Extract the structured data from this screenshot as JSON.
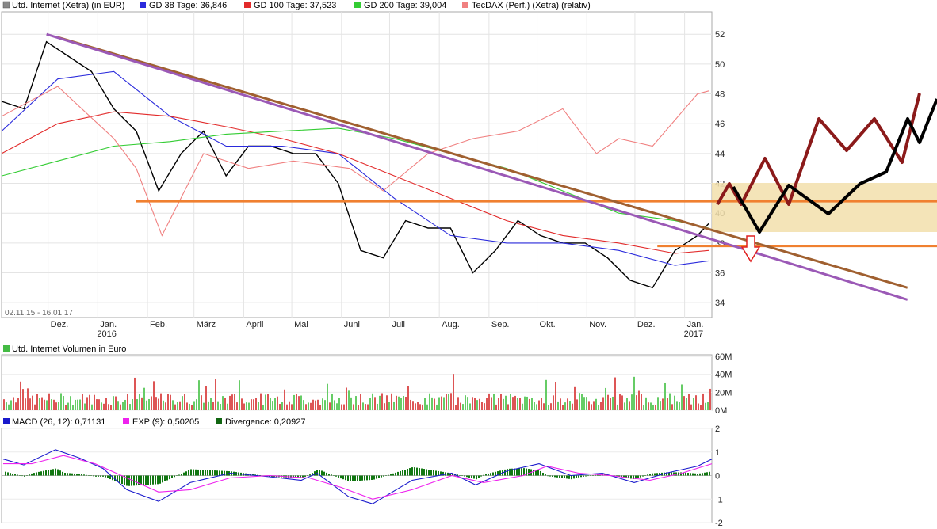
{
  "legend_main": [
    {
      "label": "Utd. Internet (Xetra) (in EUR)",
      "color": "#888888"
    },
    {
      "label": "GD 38 Tage: 36,846",
      "color": "#2a2adc"
    },
    {
      "label": "GD 100 Tage: 37,523",
      "color": "#e22a2a"
    },
    {
      "label": "GD 200 Tage: 39,004",
      "color": "#33cc33"
    },
    {
      "label": "TecDAX (Perf.) (Xetra) (relativ)",
      "color": "#f08080"
    }
  ],
  "date_range": "02.11.15 - 16.01.17",
  "legend_volume": [
    {
      "label": "Utd. Internet Volumen in Euro",
      "color": "#44bb44"
    }
  ],
  "legend_macd": [
    {
      "label": "MACD (26, 12): 0,71131",
      "color": "#1a1acc"
    },
    {
      "label": "EXP (9): 0,50205",
      "color": "#ee22ee"
    },
    {
      "label": "Divergence: 0,20927",
      "color": "#116611"
    }
  ],
  "x_ticks": [
    {
      "label": "Dez.",
      "sub": ""
    },
    {
      "label": "Jan.",
      "sub": "2016"
    },
    {
      "label": "Feb.",
      "sub": ""
    },
    {
      "label": "März",
      "sub": ""
    },
    {
      "label": "April",
      "sub": ""
    },
    {
      "label": "Mai",
      "sub": ""
    },
    {
      "label": "Juni",
      "sub": ""
    },
    {
      "label": "Juli",
      "sub": ""
    },
    {
      "label": "Aug.",
      "sub": ""
    },
    {
      "label": "Sep.",
      "sub": ""
    },
    {
      "label": "Okt.",
      "sub": ""
    },
    {
      "label": "Nov.",
      "sub": ""
    },
    {
      "label": "Dez.",
      "sub": ""
    },
    {
      "label": "Jan.",
      "sub": "2017"
    }
  ],
  "chart_data": [
    {
      "type": "line",
      "panel": "price",
      "ylim": [
        33,
        53.5
      ],
      "y_ticks": [
        34,
        36,
        38,
        40,
        42,
        44,
        46,
        48,
        50,
        52
      ],
      "grid": true,
      "series": [
        {
          "name": "Utd. Internet (Xetra) (in EUR)",
          "color": "#000000",
          "x": [
            "2015-11-02",
            "2015-11-16",
            "2015-11-30",
            "2015-12-14",
            "2015-12-28",
            "2016-01-11",
            "2016-01-25",
            "2016-02-08",
            "2016-02-22",
            "2016-03-07",
            "2016-03-21",
            "2016-04-04",
            "2016-04-18",
            "2016-05-02",
            "2016-05-16",
            "2016-05-30",
            "2016-06-13",
            "2016-06-27",
            "2016-07-11",
            "2016-07-25",
            "2016-08-08",
            "2016-08-22",
            "2016-09-05",
            "2016-09-19",
            "2016-10-03",
            "2016-10-17",
            "2016-10-31",
            "2016-11-14",
            "2016-11-28",
            "2016-12-12",
            "2016-12-26",
            "2017-01-09",
            "2017-01-16"
          ],
          "values": [
            47.5,
            47.0,
            51.5,
            50.5,
            49.5,
            47.0,
            45.5,
            41.5,
            44.0,
            45.5,
            42.5,
            44.5,
            44.5,
            44.0,
            44.0,
            42.0,
            37.5,
            37.0,
            39.5,
            39.0,
            39.0,
            36.0,
            37.5,
            39.5,
            38.5,
            38.0,
            38.0,
            37.0,
            35.5,
            35.0,
            37.5,
            38.5,
            39.3
          ]
        },
        {
          "name": "GD 38 Tage: 36,846",
          "color": "#2a2adc",
          "x": [
            "2015-11-02",
            "2015-12-07",
            "2016-01-11",
            "2016-02-15",
            "2016-03-21",
            "2016-04-25",
            "2016-05-30",
            "2016-07-04",
            "2016-08-08",
            "2016-09-12",
            "2016-10-17",
            "2016-11-21",
            "2016-12-26",
            "2017-01-16"
          ],
          "values": [
            45.5,
            49.0,
            49.5,
            46.5,
            44.5,
            44.5,
            44.0,
            41.0,
            38.5,
            38.0,
            38.0,
            37.5,
            36.5,
            36.8
          ]
        },
        {
          "name": "GD 100 Tage: 37,523",
          "color": "#e22a2a",
          "x": [
            "2015-11-02",
            "2015-12-07",
            "2016-01-11",
            "2016-02-15",
            "2016-03-21",
            "2016-04-25",
            "2016-05-30",
            "2016-07-04",
            "2016-08-08",
            "2016-09-12",
            "2016-10-17",
            "2016-11-21",
            "2016-12-26",
            "2017-01-16"
          ],
          "values": [
            44.0,
            46.0,
            46.8,
            46.5,
            45.8,
            45.0,
            44.0,
            42.5,
            41.0,
            39.5,
            38.5,
            38.0,
            37.3,
            37.5
          ]
        },
        {
          "name": "GD 200 Tage: 39,004",
          "color": "#33cc33",
          "x": [
            "2015-11-02",
            "2015-12-07",
            "2016-01-11",
            "2016-02-15",
            "2016-03-21",
            "2016-04-25",
            "2016-05-30",
            "2016-07-04",
            "2016-08-08",
            "2016-09-12",
            "2016-10-17",
            "2016-11-21",
            "2016-12-26",
            "2017-01-16"
          ],
          "values": [
            42.5,
            43.5,
            44.5,
            44.8,
            45.3,
            45.5,
            45.7,
            45.0,
            44.0,
            43.0,
            41.5,
            40.0,
            39.5,
            39.0
          ]
        },
        {
          "name": "TecDAX (Perf.) (Xetra) (relativ)",
          "color": "#f08080",
          "x": [
            "2015-11-02",
            "2015-12-07",
            "2016-01-11",
            "2016-01-25",
            "2016-02-10",
            "2016-03-07",
            "2016-04-04",
            "2016-05-02",
            "2016-06-06",
            "2016-06-27",
            "2016-07-25",
            "2016-08-22",
            "2016-09-19",
            "2016-10-17",
            "2016-11-07",
            "2016-11-21",
            "2016-12-12",
            "2017-01-09",
            "2017-01-16"
          ],
          "values": [
            46.5,
            48.5,
            45.0,
            43.0,
            38.5,
            44.0,
            43.0,
            43.5,
            43.0,
            41.5,
            44.0,
            45.0,
            45.5,
            47.0,
            44.0,
            45.0,
            44.5,
            48.0,
            48.2
          ]
        }
      ],
      "annotations": [
        {
          "type": "horizontal-line",
          "y": 40.8,
          "color": "#f08030"
        },
        {
          "type": "horizontal-line",
          "y": 37.8,
          "color": "#f08030"
        },
        {
          "type": "trendline",
          "color": "#a06030",
          "from": [
            "2015-12-07",
            51.8
          ],
          "to": [
            "2017-05-20",
            35.0
          ]
        },
        {
          "type": "trendline",
          "color": "#9b59b6",
          "from": [
            "2015-11-30",
            52.0
          ],
          "to": [
            "2017-05-20",
            34.2
          ]
        }
      ]
    },
    {
      "type": "bar",
      "panel": "volume",
      "ylim": [
        0,
        60
      ],
      "y_ticks": [
        "0M",
        "20M",
        "40M",
        "60M"
      ],
      "grid": true
    },
    {
      "type": "line",
      "panel": "macd",
      "ylim": [
        -2,
        2
      ],
      "y_ticks": [
        -2,
        -1,
        0,
        1,
        2
      ],
      "grid": true
    }
  ]
}
